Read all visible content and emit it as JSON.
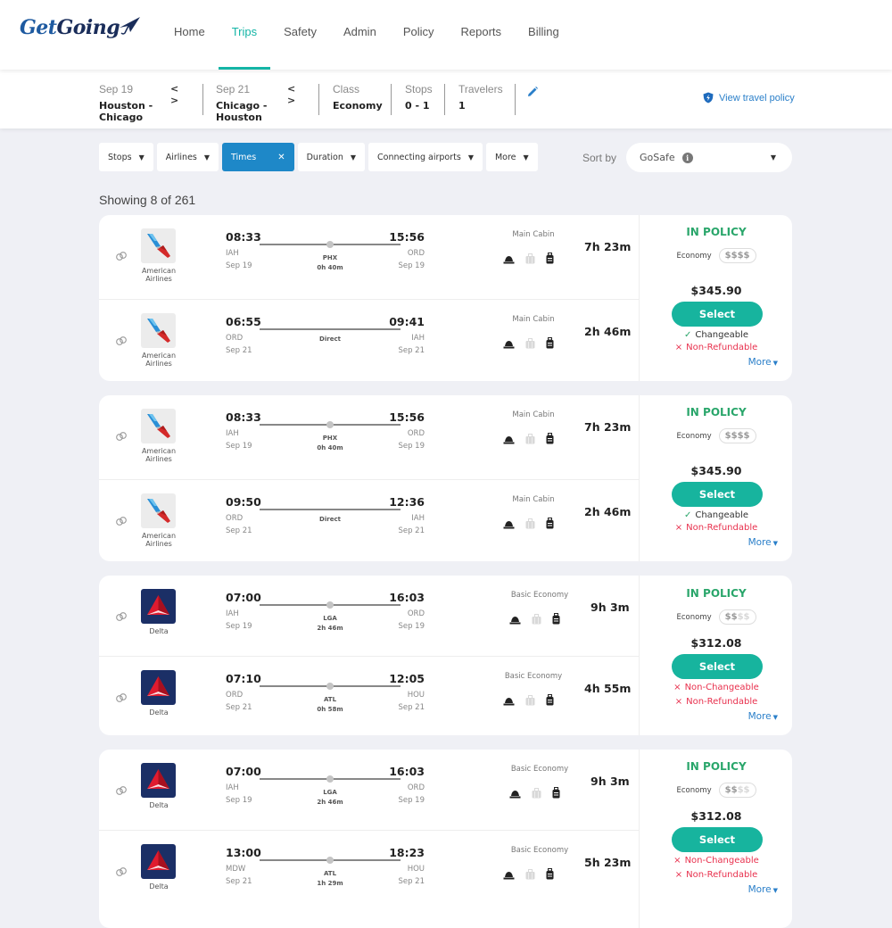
{
  "app": {
    "logo_part1": "Get",
    "logo_part2": "Going"
  },
  "nav": {
    "items": [
      {
        "label": "Home",
        "active": false
      },
      {
        "label": "Trips",
        "active": true
      },
      {
        "label": "Safety",
        "active": false
      },
      {
        "label": "Admin",
        "active": false
      },
      {
        "label": "Policy",
        "active": false
      },
      {
        "label": "Reports",
        "active": false
      },
      {
        "label": "Billing",
        "active": false
      }
    ]
  },
  "search": {
    "outbound_date": "Sep 19",
    "outbound_route": "Houston - Chicago",
    "return_date": "Sep 21",
    "return_route": "Chicago - Houston",
    "class_label": "Class",
    "class_value": "Economy",
    "stops_label": "Stops",
    "stops_value": "0 - 1",
    "travelers_label": "Travelers",
    "travelers_value": "1",
    "arrows": "< >",
    "policy_link": "View travel policy"
  },
  "filters": {
    "items": [
      {
        "label": "Stops",
        "active": false
      },
      {
        "label": "Airlines",
        "active": false
      },
      {
        "label": "Times",
        "active": true
      },
      {
        "label": "Duration",
        "active": false
      },
      {
        "label": "Connecting airports",
        "active": false
      },
      {
        "label": "More",
        "active": false
      }
    ],
    "sort_label": "Sort by",
    "sort_value": "GoSafe",
    "caret": "▼",
    "close": "✕"
  },
  "results": {
    "showing": "Showing 8 of 261",
    "cards": [
      {
        "policy": "IN POLICY",
        "class": "Economy",
        "dollars_on": "$$$$",
        "dollars_off": "",
        "price": "$345.90",
        "select": "Select",
        "features": [
          {
            "mark": "✓",
            "text": "Changeable",
            "type": "good"
          },
          {
            "mark": "×",
            "text": "Non-Refundable",
            "type": "bad"
          }
        ],
        "more": "More",
        "legs": [
          {
            "airline": "American Airlines",
            "brand": "aa",
            "dep_time": "08:33",
            "arr_time": "15:56",
            "dep_ap": "IAH",
            "arr_ap": "ORD",
            "dep_date": "Sep 19",
            "arr_date": "Sep 19",
            "stop": "PHX",
            "layover": "0h 40m",
            "cabin": "Main Cabin",
            "duration": "7h 23m"
          },
          {
            "airline": "American Airlines",
            "brand": "aa",
            "dep_time": "06:55",
            "arr_time": "09:41",
            "dep_ap": "ORD",
            "arr_ap": "IAH",
            "dep_date": "Sep 21",
            "arr_date": "Sep 21",
            "stop": "Direct",
            "layover": "",
            "cabin": "Main Cabin",
            "duration": "2h 46m"
          }
        ]
      },
      {
        "policy": "IN POLICY",
        "class": "Economy",
        "dollars_on": "$$$$",
        "dollars_off": "",
        "price": "$345.90",
        "select": "Select",
        "features": [
          {
            "mark": "✓",
            "text": "Changeable",
            "type": "good"
          },
          {
            "mark": "×",
            "text": "Non-Refundable",
            "type": "bad"
          }
        ],
        "more": "More",
        "legs": [
          {
            "airline": "American Airlines",
            "brand": "aa",
            "dep_time": "08:33",
            "arr_time": "15:56",
            "dep_ap": "IAH",
            "arr_ap": "ORD",
            "dep_date": "Sep 19",
            "arr_date": "Sep 19",
            "stop": "PHX",
            "layover": "0h 40m",
            "cabin": "Main Cabin",
            "duration": "7h 23m"
          },
          {
            "airline": "American Airlines",
            "brand": "aa",
            "dep_time": "09:50",
            "arr_time": "12:36",
            "dep_ap": "ORD",
            "arr_ap": "IAH",
            "dep_date": "Sep 21",
            "arr_date": "Sep 21",
            "stop": "Direct",
            "layover": "",
            "cabin": "Main Cabin",
            "duration": "2h 46m"
          }
        ]
      },
      {
        "policy": "IN POLICY",
        "class": "Economy",
        "dollars_on": "$$",
        "dollars_off": "$$",
        "price": "$312.08",
        "select": "Select",
        "features": [
          {
            "mark": "×",
            "text": "Non-Changeable",
            "type": "bad"
          },
          {
            "mark": "×",
            "text": "Non-Refundable",
            "type": "bad"
          }
        ],
        "more": "More",
        "legs": [
          {
            "airline": "Delta",
            "brand": "delta",
            "dep_time": "07:00",
            "arr_time": "16:03",
            "dep_ap": "IAH",
            "arr_ap": "ORD",
            "dep_date": "Sep 19",
            "arr_date": "Sep 19",
            "stop": "LGA",
            "layover": "2h 46m",
            "cabin": "Basic Economy",
            "duration": "9h 3m"
          },
          {
            "airline": "Delta",
            "brand": "delta",
            "dep_time": "07:10",
            "arr_time": "12:05",
            "dep_ap": "ORD",
            "arr_ap": "HOU",
            "dep_date": "Sep 21",
            "arr_date": "Sep 21",
            "stop": "ATL",
            "layover": "0h 58m",
            "cabin": "Basic Economy",
            "duration": "4h 55m"
          }
        ]
      },
      {
        "policy": "IN POLICY",
        "class": "Economy",
        "dollars_on": "$$",
        "dollars_off": "$$",
        "price": "$312.08",
        "select": "Select",
        "features": [
          {
            "mark": "×",
            "text": "Non-Changeable",
            "type": "bad"
          },
          {
            "mark": "×",
            "text": "Non-Refundable",
            "type": "bad"
          }
        ],
        "more": "More",
        "legs": [
          {
            "airline": "Delta",
            "brand": "delta",
            "dep_time": "07:00",
            "arr_time": "16:03",
            "dep_ap": "IAH",
            "arr_ap": "ORD",
            "dep_date": "Sep 19",
            "arr_date": "Sep 19",
            "stop": "LGA",
            "layover": "2h 46m",
            "cabin": "Basic Economy",
            "duration": "9h 3m"
          },
          {
            "airline": "Delta",
            "brand": "delta",
            "dep_time": "13:00",
            "arr_time": "18:23",
            "dep_ap": "MDW",
            "arr_ap": "HOU",
            "dep_date": "Sep 21",
            "arr_date": "Sep 21",
            "stop": "ATL",
            "layover": "1h 29m",
            "cabin": "Basic Economy",
            "duration": "5h 23m"
          }
        ]
      }
    ]
  },
  "colors": {
    "accent": "#14b5a6",
    "select_button": "#17b49e",
    "active_filter": "#1e88c8",
    "in_policy": "#2aa66b",
    "negative": "#e8304d",
    "link": "#2a7fc9"
  }
}
